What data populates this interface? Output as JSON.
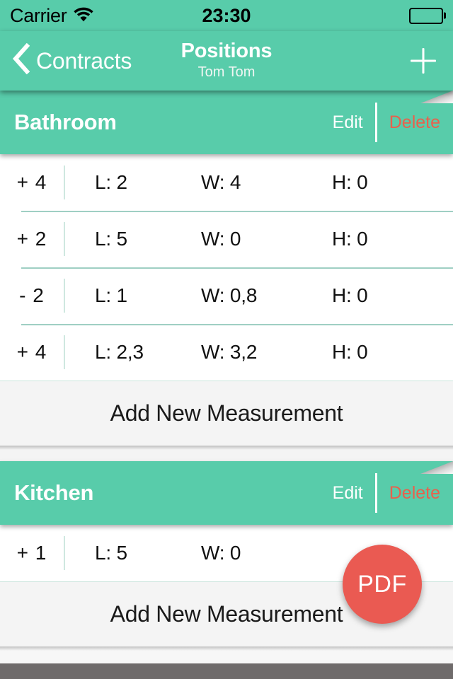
{
  "status_bar": {
    "carrier": "Carrier",
    "wifi_icon": "wifi-icon",
    "time": "23:30",
    "battery_icon": "battery-full-icon"
  },
  "nav_bar": {
    "back_icon": "chevron-left-icon",
    "back_label": "Contracts",
    "title": "Positions",
    "subtitle": "Tom Tom",
    "add_icon": "plus-icon"
  },
  "theme": {
    "accent": "#58CCAA",
    "delete": "#E8614D",
    "fab": "#EA5A52",
    "row_divider": "#9fcfc3"
  },
  "sections": [
    {
      "title": "Bathroom",
      "edit_label": "Edit",
      "delete_label": "Delete",
      "footer_label": "Add New Measurement",
      "rows": [
        {
          "qty": "+ 4",
          "length": "L: 2",
          "width": "W: 4",
          "height": "H: 0"
        },
        {
          "qty": "+ 2",
          "length": "L: 5",
          "width": "W: 0",
          "height": "H: 0"
        },
        {
          "qty": "- 2",
          "length": "L: 1",
          "width": "W: 0,8",
          "height": "H: 0"
        },
        {
          "qty": "+ 4",
          "length": "L: 2,3",
          "width": "W: 3,2",
          "height": "H: 0"
        }
      ]
    },
    {
      "title": "Kitchen",
      "edit_label": "Edit",
      "delete_label": "Delete",
      "footer_label": "Add New Measurement",
      "rows": [
        {
          "qty": "+ 1",
          "length": "L: 5",
          "width": "W: 0",
          "height": ""
        }
      ]
    }
  ],
  "fab": {
    "label": "PDF"
  }
}
